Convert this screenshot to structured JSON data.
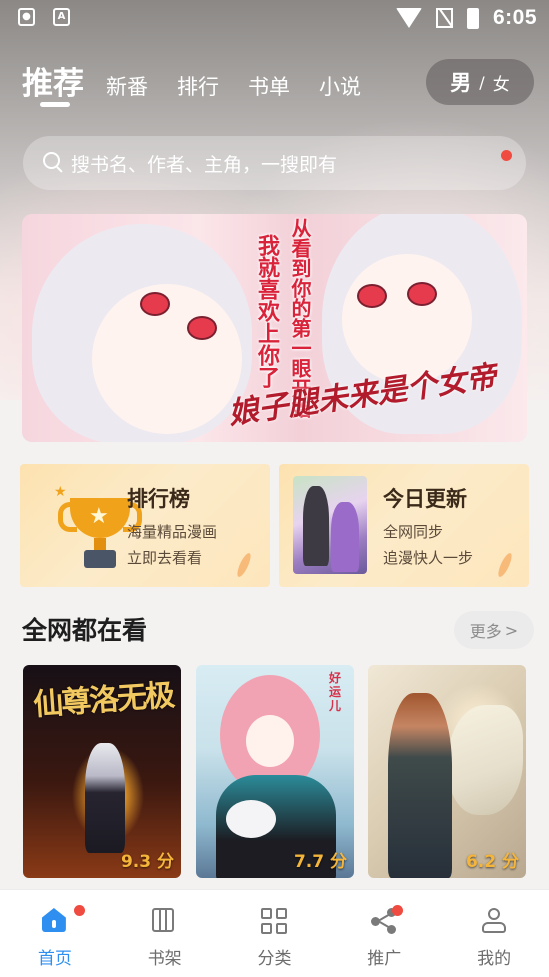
{
  "status_bar": {
    "time": "6:05",
    "left_icons": [
      "lock-app-icon",
      "font-app-icon"
    ],
    "right_icons": [
      "wifi-icon",
      "no-sim-icon",
      "battery-charging-icon"
    ]
  },
  "top_tabs": {
    "items": [
      {
        "label": "推荐",
        "active": true
      },
      {
        "label": "新番",
        "active": false
      },
      {
        "label": "排行",
        "active": false
      },
      {
        "label": "书单",
        "active": false
      },
      {
        "label": "小说",
        "active": false
      }
    ],
    "gender_toggle": {
      "male": "男",
      "separator": "/",
      "female": "女",
      "selected": "男"
    }
  },
  "search": {
    "placeholder": "搜书名、作者、主角，一搜即有",
    "has_notification_dot": true
  },
  "banner": {
    "text_lines": [
      "从看到你的第一眼开始",
      "我就喜欢上你了"
    ],
    "logo_text": "娘子腿未来是个女帝"
  },
  "feature_cards": [
    {
      "title": "排行榜",
      "subtitle_1": "海量精品漫画",
      "subtitle_2": "立即去看看",
      "icon": "trophy-icon"
    },
    {
      "title": "今日更新",
      "subtitle_1": "全网同步",
      "subtitle_2": "追漫快人一步",
      "icon": "comic-cover-icon"
    }
  ],
  "section": {
    "title": "全网都在看",
    "more_label": "更多",
    "more_chevron": ">"
  },
  "covers": [
    {
      "title_art": "仙尊洛无极",
      "score": "9.3 分"
    },
    {
      "title_art": "好运儿",
      "score": "7.7 分"
    },
    {
      "title_art": "",
      "score": "6.2 分"
    }
  ],
  "bottom_nav": [
    {
      "label": "首页",
      "icon": "home-icon",
      "active": true,
      "dot": true
    },
    {
      "label": "书架",
      "icon": "bookshelf-icon",
      "active": false,
      "dot": false
    },
    {
      "label": "分类",
      "icon": "category-grid-icon",
      "active": false,
      "dot": false
    },
    {
      "label": "推广",
      "icon": "share-icon",
      "active": false,
      "dot": true
    },
    {
      "label": "我的",
      "icon": "user-icon",
      "active": false,
      "dot": false
    }
  ],
  "colors": {
    "accent_blue": "#2f8ff0",
    "notification_red": "#f04b40",
    "score_gold": "#f5b53a",
    "card_bg": "#fde2b0"
  }
}
